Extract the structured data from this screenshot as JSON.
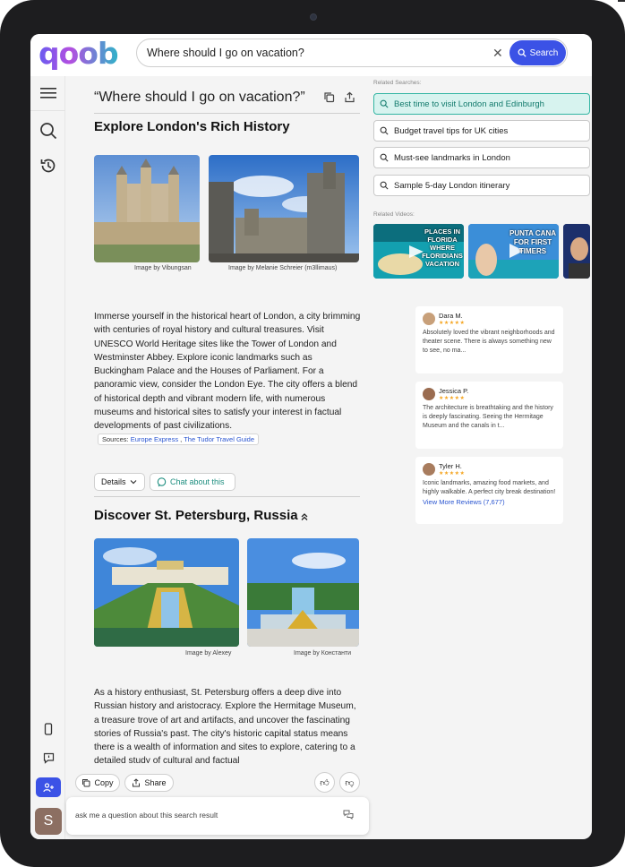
{
  "app": {
    "logo": "qoob"
  },
  "search": {
    "query": "Where should I go on vacation?",
    "button_label": "Search"
  },
  "result": {
    "title": "“Where should I go on vacation?”"
  },
  "sections": [
    {
      "heading": "Explore London's Rich History",
      "captions": [
        "Image by Vibungsan",
        "Image by Melanie Schreier (m3llimaus)"
      ],
      "paragraph": "Immerse yourself in the historical heart of London, a city brimming with centuries of royal history and cultural treasures. Visit UNESCO World Heritage sites like the Tower of London and Westminster Abbey. Explore iconic landmarks such as Buckingham Palace and the Houses of Parliament. For a panoramic view, consider the London Eye. The city offers a blend of historical depth and vibrant modern life, with numerous museums and historical sites to satisfy your interest in factual developments of past civilizations.",
      "sources_label": "Sources:",
      "sources": [
        "Europe Express",
        "The Tudor Travel Guide"
      ],
      "details_label": "Details",
      "chat_label": "Chat about this"
    },
    {
      "heading": "Discover St. Petersburg, Russia",
      "captions": [
        "Image by Alexey",
        "Image by Константи"
      ],
      "paragraph": "As a history enthusiast, St. Petersburg offers a deep dive into Russian history and aristocracy. Explore the Hermitage Museum, a treasure trove of art and artifacts, and uncover the fascinating stories of Russia's past. The city's historic capital status means there is a wealth of information and sites to explore, catering to a detailed study of cultural and factual"
    }
  ],
  "related_searches": {
    "label": "Related Searches:",
    "items": [
      "Best time to visit London and Edinburgh",
      "Budget travel tips for UK cities",
      "Must-see landmarks in London",
      "Sample 5-day London itinerary"
    ]
  },
  "related_videos": {
    "label": "Related Videos:",
    "items": [
      {
        "title": "PLACES IN FLORIDA WHERE FLORIDIANS VACATION",
        "color": "#0f7c8c"
      },
      {
        "title": "PUNTA CANA FOR FIRST TIMERS",
        "color": "#2a6fc2"
      },
      {
        "title": "",
        "color": "#2a3b6e"
      }
    ]
  },
  "reviews": [
    {
      "name": "Dara M.",
      "stars": "★★★★★",
      "text": "Absolutely loved the vibrant neighborhoods and theater scene. There is always something new to see, no ma..."
    },
    {
      "name": "Jessica P.",
      "stars": "★★★★★",
      "text": "The architecture is breathtaking and the history is deeply fascinating. Seeing the Hermitage Museum and the canals in t..."
    },
    {
      "name": "Tyler H.",
      "stars": "★★★★★",
      "text": "Iconic landmarks, amazing food markets, and highly walkable. A perfect city break destination!",
      "link": "View More Reviews (7,677)"
    }
  ],
  "actions": {
    "copy": "Copy",
    "share": "Share"
  },
  "ask": {
    "placeholder": "ask me a question about this search result"
  },
  "user": {
    "initial": "S"
  },
  "colors": {
    "accent": "#3b52e6",
    "teal": "#33b5a3"
  }
}
